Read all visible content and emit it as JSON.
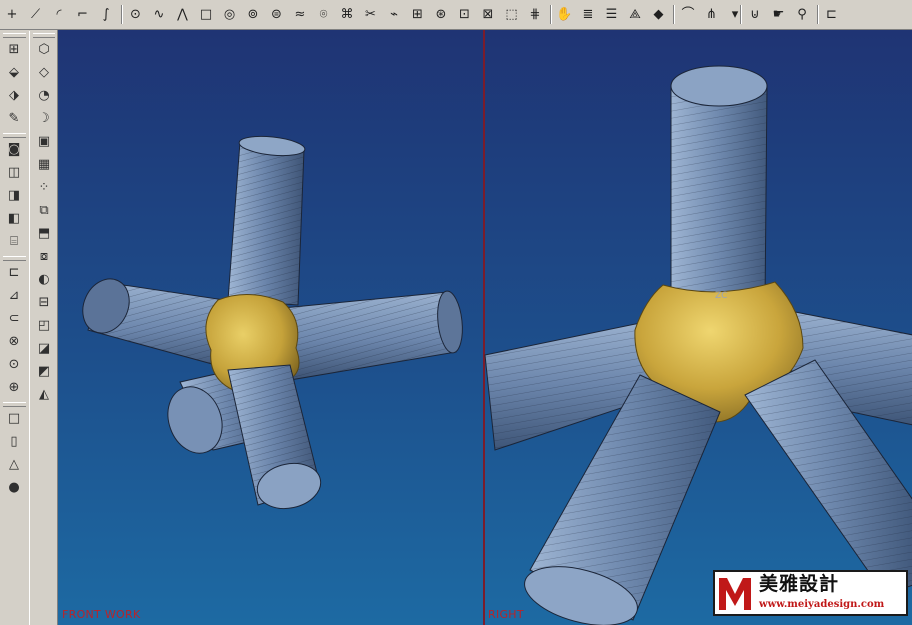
{
  "toolbar": {
    "buttons": [
      {
        "icon": "point-cross-icon",
        "glyph": "+"
      },
      {
        "icon": "line-icon",
        "glyph": "⟋"
      },
      {
        "icon": "arc-icon",
        "glyph": "◜"
      },
      {
        "icon": "rectangle-corner-icon",
        "glyph": "⌐"
      },
      {
        "icon": "spline-icon",
        "glyph": "∫"
      },
      {
        "icon": "point-icon",
        "glyph": "⊙"
      },
      {
        "icon": "polyline-icon",
        "glyph": "∿"
      },
      {
        "icon": "profile-icon",
        "glyph": "⋀"
      },
      {
        "icon": "square-icon",
        "glyph": "□"
      },
      {
        "icon": "circle-icon",
        "glyph": "◎"
      },
      {
        "icon": "ellipse-icon",
        "glyph": "⊚"
      },
      {
        "icon": "helix-icon",
        "glyph": "⊜"
      },
      {
        "icon": "curve-text-icon",
        "glyph": "≈"
      },
      {
        "icon": "offset-curve-icon",
        "glyph": "⌾"
      },
      {
        "icon": "bridge-curve-icon",
        "glyph": "⌘"
      },
      {
        "icon": "trim-curve-icon",
        "glyph": "✂"
      },
      {
        "icon": "edit-curve-icon",
        "glyph": "⌁"
      },
      {
        "icon": "project-curve-icon",
        "glyph": "⊞"
      },
      {
        "icon": "wrap-curve-icon",
        "glyph": "⊛"
      },
      {
        "icon": "isoparametric-curve-icon",
        "glyph": "⊡"
      },
      {
        "icon": "intersect-curve-icon",
        "glyph": "⊠"
      },
      {
        "icon": "extract-curve-icon",
        "glyph": "⬚"
      },
      {
        "icon": "through-curves-icon",
        "glyph": "⋕"
      },
      {
        "icon": "hand-select-icon",
        "glyph": "✋"
      },
      {
        "icon": "layers-icon",
        "glyph": "≣"
      },
      {
        "icon": "stacked-sheets-icon",
        "glyph": "☰"
      },
      {
        "icon": "section-icon",
        "glyph": "⟁"
      },
      {
        "icon": "multicolor-surface-icon",
        "glyph": "◆"
      },
      {
        "icon": "curve-analysis-icon",
        "glyph": "⌒"
      },
      {
        "icon": "comb-analysis-icon",
        "glyph": "⋔"
      },
      {
        "icon": "dropdown-icon",
        "glyph": "▾"
      },
      {
        "icon": "draft-analysis-icon",
        "glyph": "⊍"
      },
      {
        "icon": "hand-tool-icon",
        "glyph": "☛"
      },
      {
        "icon": "zoom-icon",
        "glyph": "⚲"
      },
      {
        "icon": "fit-view-icon",
        "glyph": "⊏"
      }
    ]
  },
  "left_tools_a": [
    {
      "icon": "grid-layout-icon",
      "glyph": "⊞"
    },
    {
      "icon": "cube-tools-icon",
      "glyph": "⬙"
    },
    {
      "icon": "trim-body-icon",
      "glyph": "⬗"
    },
    {
      "icon": "pencil-icon",
      "glyph": "✎"
    },
    {
      "icon": "hole-icon",
      "glyph": "◙"
    },
    {
      "icon": "boss-icon",
      "glyph": "◫"
    },
    {
      "icon": "pocket-icon",
      "glyph": "◨"
    },
    {
      "icon": "pad-icon",
      "glyph": "◧"
    },
    {
      "icon": "slot-icon",
      "glyph": "⌸"
    },
    {
      "icon": "groove-icon",
      "glyph": "⊏"
    },
    {
      "icon": "dart-icon",
      "glyph": "⊿"
    },
    {
      "icon": "tube-icon",
      "glyph": "⊂"
    },
    {
      "icon": "extract-body-icon",
      "glyph": "⊗"
    },
    {
      "icon": "sew-icon",
      "glyph": "⊙"
    },
    {
      "icon": "patch-icon",
      "glyph": "⊕"
    },
    {
      "icon": "box-primitive-icon",
      "glyph": "□"
    },
    {
      "icon": "cylinder-primitive-icon",
      "glyph": "▯"
    },
    {
      "icon": "cone-primitive-icon",
      "glyph": "△"
    },
    {
      "icon": "sphere-primitive-icon",
      "glyph": "●"
    }
  ],
  "left_tools_b": [
    {
      "icon": "extrude-icon",
      "glyph": "⬡"
    },
    {
      "icon": "revolve-icon",
      "glyph": "◇"
    },
    {
      "icon": "blend-icon",
      "glyph": "◔"
    },
    {
      "icon": "chamfer-icon",
      "glyph": "☽"
    },
    {
      "icon": "shell-icon",
      "glyph": "▣"
    },
    {
      "icon": "hollow-icon",
      "glyph": "▦"
    },
    {
      "icon": "pattern-icon",
      "glyph": "⁘"
    },
    {
      "icon": "mirror-icon",
      "glyph": "⧉"
    },
    {
      "icon": "swept-icon",
      "glyph": "⬒"
    },
    {
      "icon": "thread-icon",
      "glyph": "⧇"
    },
    {
      "icon": "offset-face-icon",
      "glyph": "◐"
    },
    {
      "icon": "scale-body-icon",
      "glyph": "⊟"
    },
    {
      "icon": "split-body-icon",
      "glyph": "◰"
    },
    {
      "icon": "unite-icon",
      "glyph": "◪"
    },
    {
      "icon": "subtract-icon",
      "glyph": "◩"
    },
    {
      "icon": "intersect-icon",
      "glyph": "◭"
    }
  ],
  "views": {
    "left_label": "FRONT WORK",
    "right_label": "RIGHT",
    "axis_label": "ZC"
  },
  "watermark": {
    "brand": "美雅設計",
    "url": "www.meiyadesign.com"
  },
  "colors": {
    "tube": "#6f8ab0",
    "tube_edge": "#1b2538",
    "joint": "#c9a73f",
    "viewport_top": "#1f3474",
    "viewport_bottom": "#1d6aa3"
  }
}
